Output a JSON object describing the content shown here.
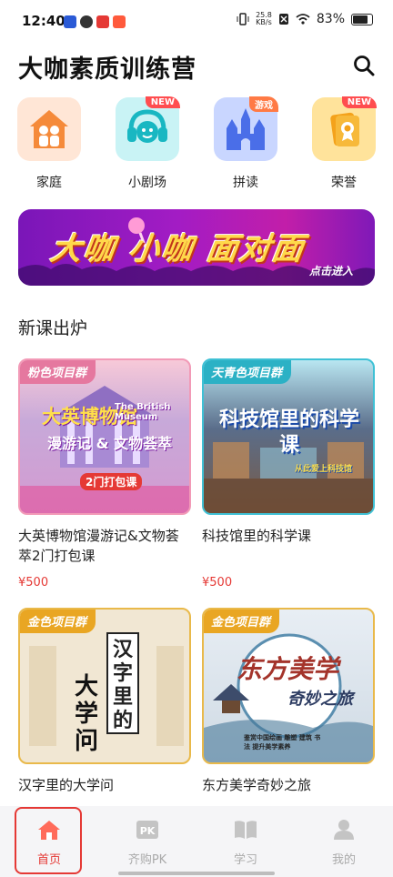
{
  "status_bar": {
    "time": "12:40",
    "speed_top": "25.8",
    "speed_bottom": "KB/s",
    "battery": "83%"
  },
  "header": {
    "title": "大咖素质训练营",
    "search_icon": "search-icon"
  },
  "categories": [
    {
      "label": "家庭",
      "icon": "family-house-icon",
      "color": "#ffe6d6",
      "badge": ""
    },
    {
      "label": "小剧场",
      "icon": "headset-mic-icon",
      "color": "#c9f3f5",
      "badge": "NEW"
    },
    {
      "label": "拼读",
      "icon": "castle-icon",
      "color": "#c9d6ff",
      "badge": "游戏"
    },
    {
      "label": "荣誉",
      "icon": "honor-badge-icon",
      "color": "#ffe39b",
      "badge": "NEW"
    }
  ],
  "banner": {
    "title": "大咖 小咖 面对面",
    "cta": "点击进入"
  },
  "section_title": "新课出炉",
  "courses": [
    {
      "title": "大英博物馆漫游记&文物荟萃2门打包课",
      "price": "¥500",
      "tag": "粉色项目群",
      "art_title": "大英博物馆",
      "art_sub": "The British Museum",
      "art_line": "漫游记 & 文物荟萃",
      "art_foot": "2门打包课"
    },
    {
      "title": "科技馆里的科学课",
      "price": "¥500",
      "tag": "天青色项目群",
      "art_title": "科技馆里的科学课",
      "art_foot": "从此爱上科技馆"
    },
    {
      "title": "汉字里的大学问",
      "price": "",
      "tag": "金色项目群",
      "art_title": "汉字里的",
      "art_big": "大学问"
    },
    {
      "title": "东方美学奇妙之旅",
      "price": "",
      "tag": "金色项目群",
      "art_title": "东方美学",
      "art_sub": "奇妙之旅",
      "art_foot": "鉴赏中国绘画 雕塑 建筑 书法 提升美学素养"
    }
  ],
  "nav": [
    {
      "label": "首页",
      "icon": "home-icon",
      "active": true
    },
    {
      "label": "齐购PK",
      "icon": "pk-icon",
      "active": false
    },
    {
      "label": "学习",
      "icon": "book-icon",
      "active": false
    },
    {
      "label": "我的",
      "icon": "person-icon",
      "active": false
    }
  ],
  "colors": {
    "accent": "#e53935",
    "banner": "#a31cc4",
    "tag_pink": "#e5789f",
    "tag_teal": "#2bb1c5",
    "tag_gold": "#e9a623"
  }
}
